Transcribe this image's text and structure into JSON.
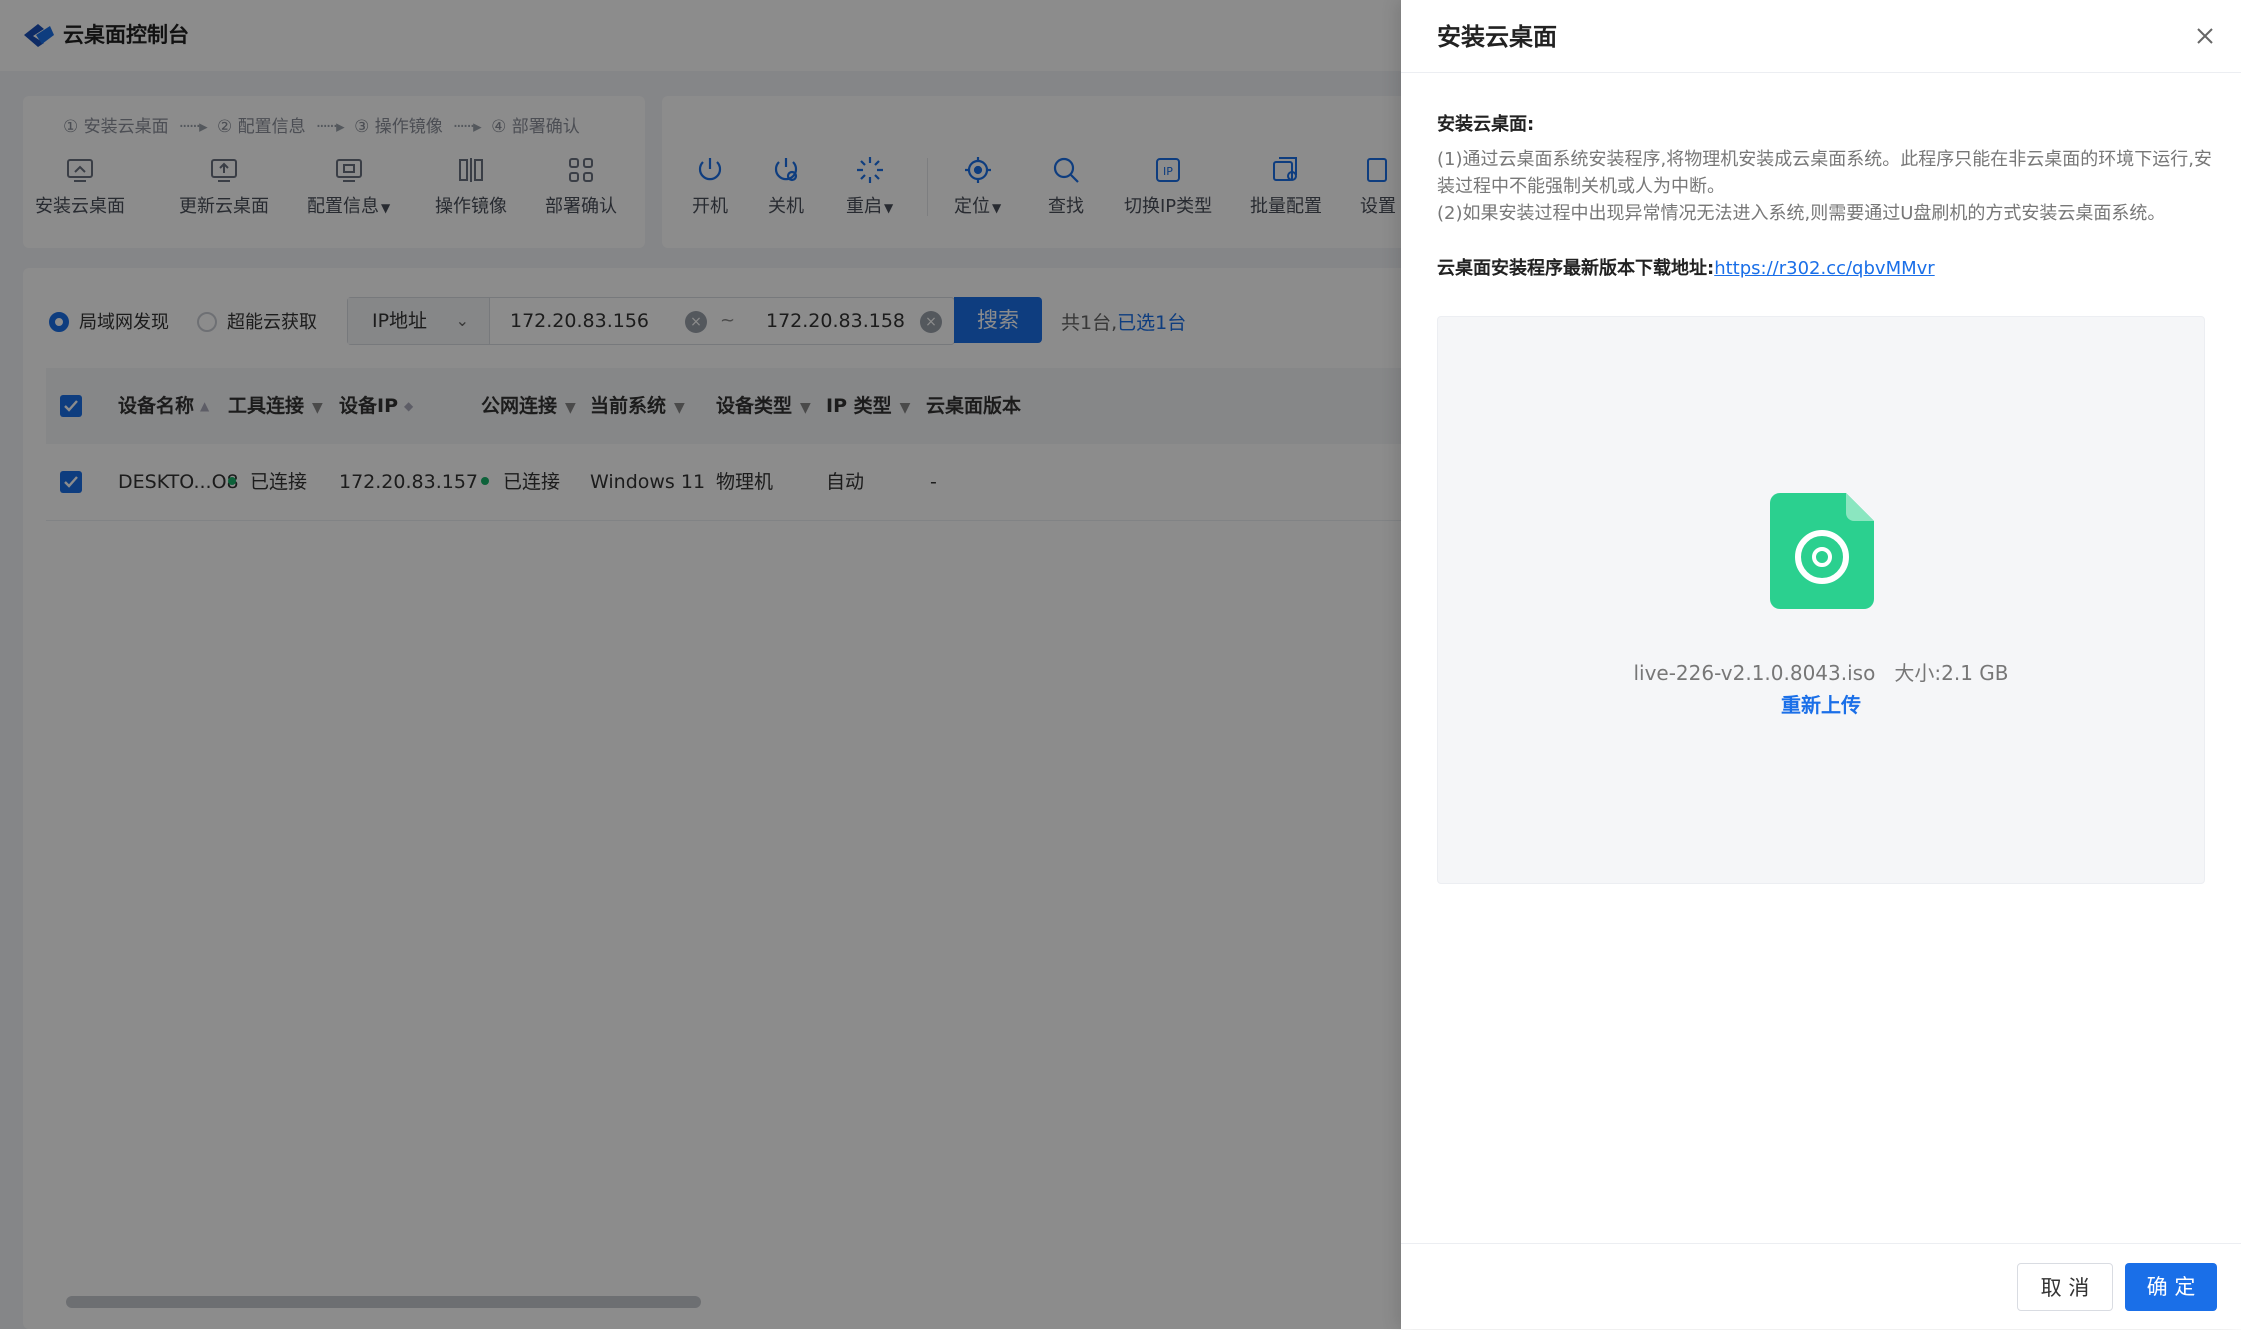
{
  "app": {
    "title": "云桌面控制台"
  },
  "wizard": {
    "steps": [
      "① 安装云桌面",
      "② 配置信息",
      "③ 操作镜像",
      "④ 部署确认"
    ],
    "arrow": "······▸",
    "tools": [
      {
        "label": "安装云桌面",
        "icon": "install-desktop-icon"
      },
      {
        "label": "更新云桌面",
        "icon": "update-desktop-icon"
      },
      {
        "label": "配置信息",
        "icon": "config-monitor-icon",
        "dropdown": true
      },
      {
        "label": "操作镜像",
        "icon": "mirror-icon"
      },
      {
        "label": "部署确认",
        "icon": "deploy-grid-icon"
      }
    ]
  },
  "ops": {
    "tools": [
      {
        "label": "开机",
        "icon": "power-icon"
      },
      {
        "label": "关机",
        "icon": "shutdown-icon"
      },
      {
        "label": "重启",
        "icon": "restart-icon",
        "dropdown": true
      },
      {
        "label": "定位",
        "icon": "locate-icon",
        "dropdown": true
      },
      {
        "label": "查找",
        "icon": "search-icon"
      },
      {
        "label": "切换IP类型",
        "icon": "ip-switch-icon"
      },
      {
        "label": "批量配置",
        "icon": "batch-config-icon"
      },
      {
        "label": "设置",
        "icon": "settings-icon"
      }
    ]
  },
  "search": {
    "mode_lan": "局域网发现",
    "mode_cloud": "超能云获取",
    "ip_type": "IP地址",
    "ip_start": "172.20.83.156",
    "ip_sep": "~",
    "ip_end": "172.20.83.158",
    "button": "搜索",
    "count_total": "共1台,",
    "count_selected": "已选1台"
  },
  "table": {
    "headers": [
      "设备名称",
      "工具连接",
      "设备IP",
      "公网连接",
      "当前系统",
      "设备类型",
      "IP 类型",
      "云桌面版本"
    ],
    "rows": [
      {
        "name": "DESKTO...O8",
        "tool_conn": "已连接",
        "ip": "172.20.83.157",
        "public_conn": "已连接",
        "os": "Windows 11",
        "type": "物理机",
        "ip_type": "自动",
        "version": "-"
      }
    ]
  },
  "drawer": {
    "title": "安装云桌面",
    "section_title": "安装云桌面:",
    "line1": "(1)通过云桌面系统安装程序,将物理机安装成云桌面系统。此程序只能在非云桌面的环境下运行,安装过程中不能强制关机或人为中断。",
    "line2": "(2)如果安装过程中出现异常情况无法进入系统,则需要通过U盘刷机的方式安装云桌面系统。",
    "download_label": "云桌面安装程序最新版本下载地址:",
    "download_link": "https://r302.cc/qbvMMvr",
    "file_name": "live-226-v2.1.0.8043.iso",
    "file_size": "大小:2.1 GB",
    "reupload": "重新上传",
    "cancel": "取 消",
    "ok": "确 定",
    "colors": {
      "primary": "#1a6fe8",
      "file_icon": "#2bd08f"
    }
  }
}
